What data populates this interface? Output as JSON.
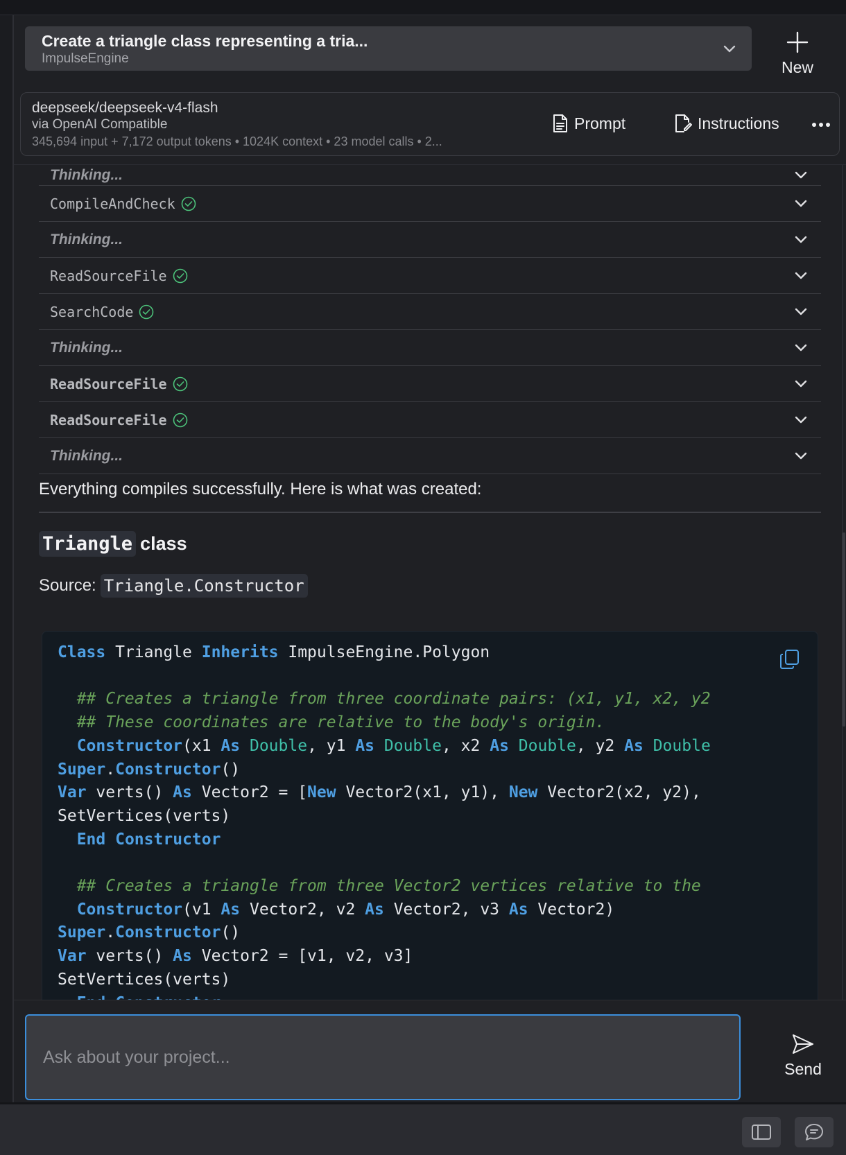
{
  "header": {
    "conversation_title": "Create a triangle class representing a tria...",
    "project_name": "ImpulseEngine",
    "new_label": "New"
  },
  "model": {
    "name": "deepseek/deepseek-v4-flash",
    "provider": "via OpenAI Compatible",
    "stats": "345,694 input + 7,172 output tokens • 1024K context • 23 model calls • 2...",
    "prompt_label": "Prompt",
    "instructions_label": "Instructions"
  },
  "steps": [
    {
      "label": "Thinking...",
      "kind": "thinking"
    },
    {
      "label": "CompileAndCheck",
      "kind": "tool"
    },
    {
      "label": "Thinking...",
      "kind": "thinking"
    },
    {
      "label": "ReadSourceFile",
      "kind": "tool"
    },
    {
      "label": "SearchCode",
      "kind": "tool"
    },
    {
      "label": "Thinking...",
      "kind": "thinking"
    },
    {
      "label": "ReadSourceFile",
      "kind": "tool"
    },
    {
      "label": "ReadSourceFile",
      "kind": "tool"
    },
    {
      "label": "Thinking...",
      "kind": "thinking"
    }
  ],
  "response": {
    "summary": "Everything compiles successfully. Here is what was created:",
    "heading_code": "Triangle",
    "heading_text": "class",
    "source_label": "Source:",
    "source_code": "Triangle.Constructor",
    "code_lines": [
      "Class Triangle Inherits ImpulseEngine.Polygon",
      "",
      "  ## Creates a triangle from three coordinate pairs: (x1, y1, x2, y2",
      "  ## These coordinates are relative to the body's origin.",
      "  Constructor(x1 As Double, y1 As Double, x2 As Double, y2 As Double",
      "Super.Constructor()",
      "Var verts() As Vector2 = [New Vector2(x1, y1), New Vector2(x2, y2),",
      "SetVertices(verts)",
      "  End Constructor",
      "",
      "  ## Creates a triangle from three Vector2 vertices relative to the",
      "  Constructor(v1 As Vector2, v2 As Vector2, v3 As Vector2)",
      "Super.Constructor()",
      "Var verts() As Vector2 = [v1, v2, v3]",
      "SetVertices(verts)",
      "  End Constructor"
    ]
  },
  "input": {
    "placeholder": "Ask about your project...",
    "send_label": "Send"
  },
  "colors": {
    "accent": "#3b8edb",
    "success": "#4cc27a",
    "keyword": "#4f9fe2",
    "type": "#3fbfa8",
    "comment": "#6aa35a"
  },
  "icons": {
    "new": "plus-icon",
    "prompt": "document-icon",
    "instructions": "edit-document-icon",
    "more": "more-dots-icon",
    "step_status": "check-circle-icon",
    "expand": "chevron-down-icon",
    "copy": "copy-icon",
    "send": "send-icon",
    "sidebar_toggle": "sidebar-toggle-icon",
    "chat": "chat-bubble-icon"
  }
}
